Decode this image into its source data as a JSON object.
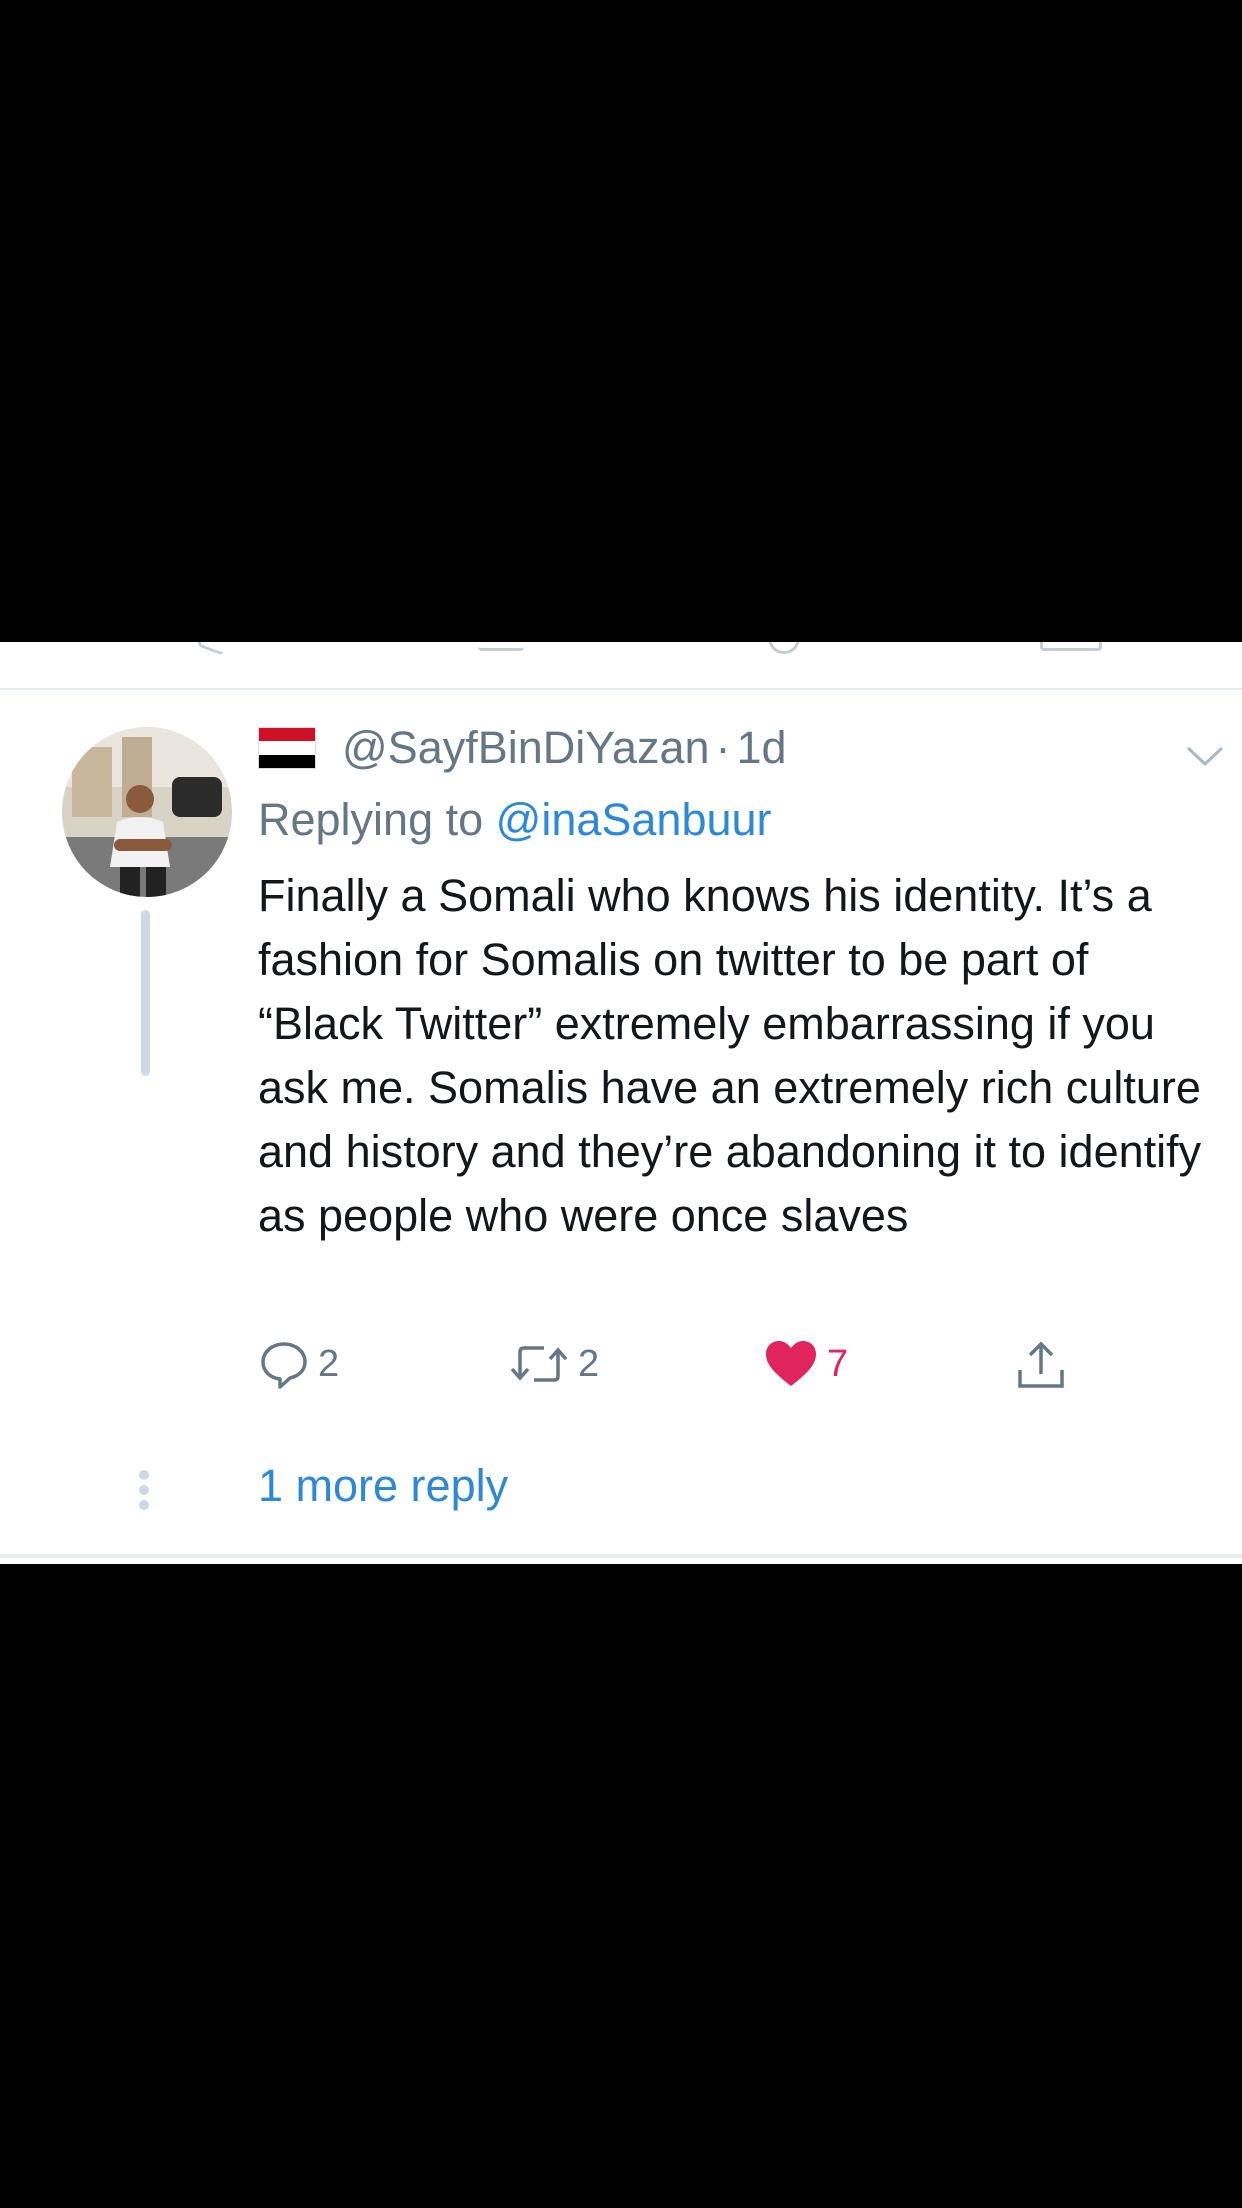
{
  "tweet": {
    "handle": "@SayfBinDiYazan",
    "separator": "·",
    "time": "1d",
    "replying_prefix": "Replying to ",
    "replying_to": "@inaSanbuur",
    "text": "Finally a Somali who knows his identity. It’s a fashion for Somalis on twitter to be part of “Black Twitter” extremely embarrassing if you ask me. Somalis have an extremely rich culture and history and they’re abandoning it to identify as people who were once slaves",
    "replies_count": "2",
    "retweets_count": "2",
    "likes_count": "7",
    "more_replies": "1 more reply"
  },
  "icons": {
    "flag": "yemen-flag-icon",
    "menu": "chevron-down-icon",
    "reply": "reply-icon",
    "retweet": "retweet-icon",
    "like": "heart-icon",
    "share": "share-icon"
  },
  "colors": {
    "link": "#2c89d8",
    "like": "#e0245e",
    "muted": "#657786",
    "text": "#14171a",
    "thread_line": "#cfd9e3",
    "background_letterbox": "#000000"
  }
}
